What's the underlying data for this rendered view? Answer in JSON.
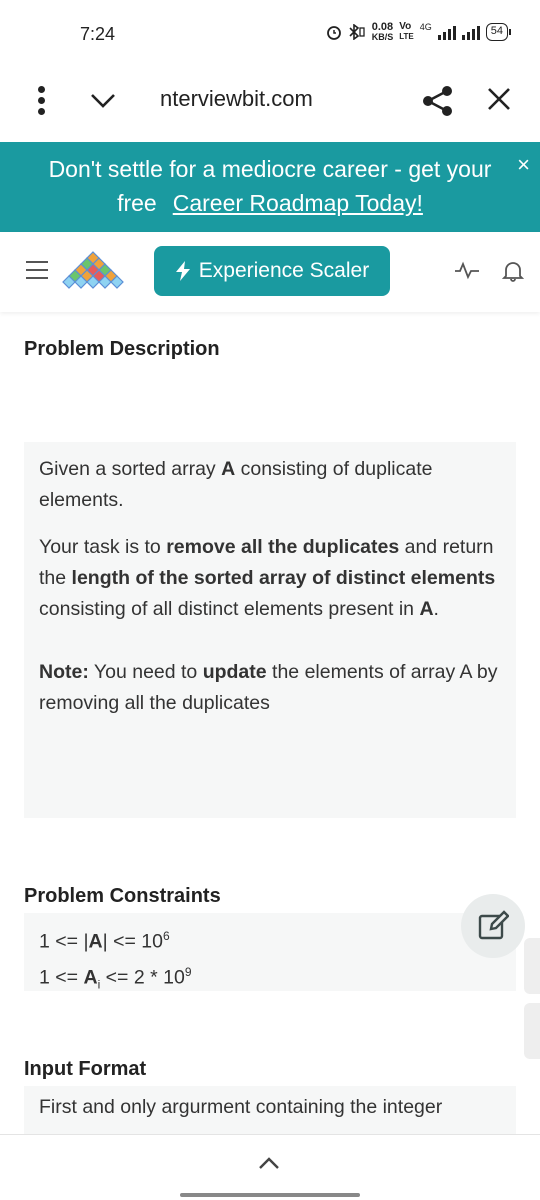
{
  "status": {
    "time": "7:24",
    "net_speed_value": "0.08",
    "net_speed_unit": "KB/S",
    "volte_top": "Vo",
    "volte_bottom": "LTE",
    "network": "4G",
    "battery": "54"
  },
  "browser": {
    "url": "nterviewbit.com"
  },
  "banner": {
    "line1": "Don't settle for a mediocre career - get your",
    "line2_prefix": "free",
    "link": "Career Roadmap Today!",
    "close": "×"
  },
  "header": {
    "cta_label": "Experience Scaler",
    "colors": {
      "brand": "#1a9aa0"
    }
  },
  "problem": {
    "section_title": "Problem Description",
    "p1_a": "Given a sorted array ",
    "p1_b": "A",
    "p1_c": " consisting of duplicate elements.",
    "p2_a": "Your task is to ",
    "p2_b": "remove all the duplicates",
    "p2_c": " and return the ",
    "p2_d": "length of the sorted array of distinct elements",
    "p2_e": " consisting of all distinct elements present in ",
    "p2_f": "A",
    "p2_g": ".",
    "note_label": "Note:",
    "note_a": " You need to ",
    "note_b": "update",
    "note_c": " the elements of array A by removing all the duplicates"
  },
  "constraints": {
    "section_title": "Problem Constraints",
    "c1_a": "1 <= |",
    "c1_b": "A",
    "c1_c": "| <= 10",
    "c1_exp": "6",
    "c2_a": "1 <= ",
    "c2_b": "A",
    "c2_sub": "i",
    "c2_c": " <= 2 * 10",
    "c2_exp": "9"
  },
  "input_format": {
    "section_title": "Input Format",
    "text": "First and only argurment containing the integer"
  }
}
